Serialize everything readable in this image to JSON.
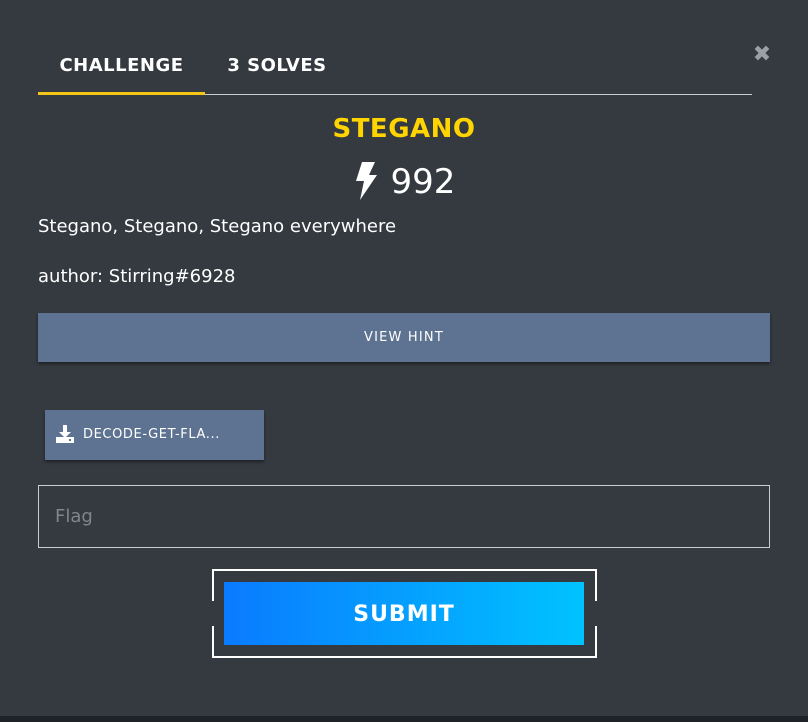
{
  "tabs": [
    {
      "label": "CHALLENGE",
      "active": true
    },
    {
      "label": "3 SOLVES",
      "active": false
    }
  ],
  "close_icon": "close-icon",
  "challenge": {
    "name": "STEGANO",
    "points": "992",
    "points_icon": "lightning-bolt-icon",
    "description": [
      "Stegano, Stegano, Stegano everywhere",
      "author: Stirring#6928"
    ]
  },
  "hint_button": {
    "label": "VIEW HINT"
  },
  "file_button": {
    "label": "DECODE-GET-FLA...",
    "icon": "download-icon"
  },
  "flag_input": {
    "placeholder": "Flag",
    "value": ""
  },
  "submit_button": {
    "label": "SUBMIT"
  },
  "colors": {
    "background": "#343a40",
    "title_accent": "#ffd400",
    "active_tab_underline": "#f5c518",
    "secondary_button": "#5e7391",
    "submit_gradient_start": "#0a7bff",
    "submit_gradient_end": "#00c3ff"
  }
}
